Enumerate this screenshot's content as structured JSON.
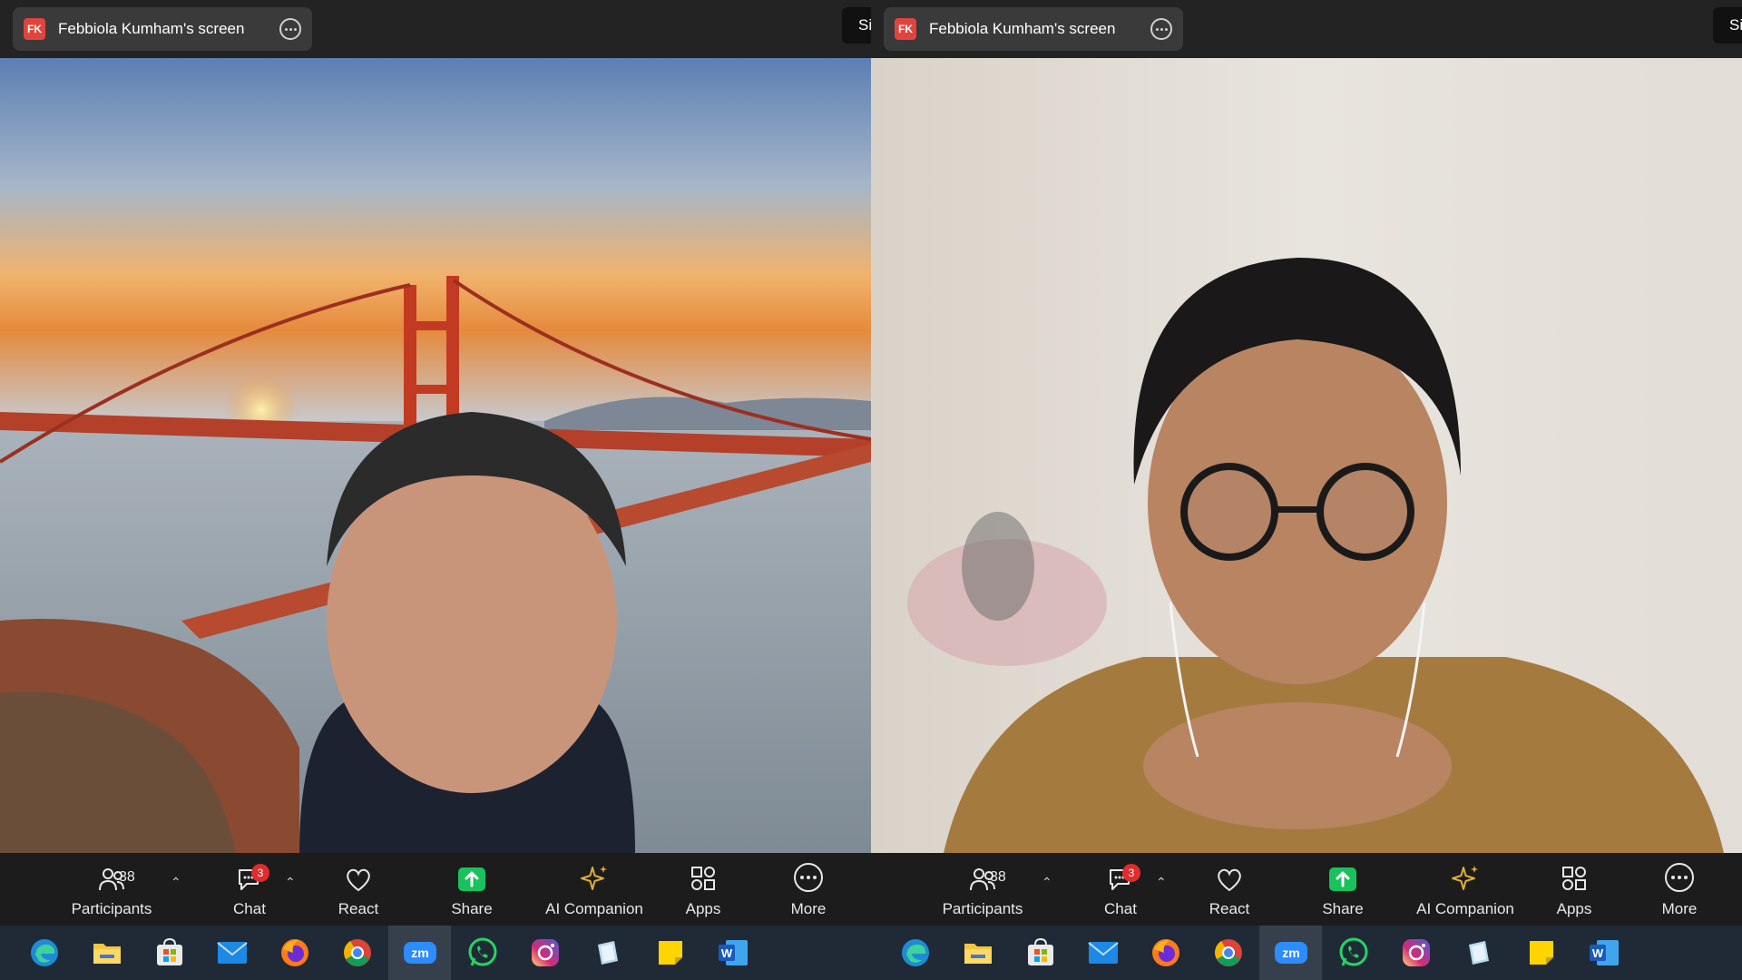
{
  "share_bar": {
    "initials": "FK",
    "title": "Febbiola Kumham's screen",
    "side_tab": "Si"
  },
  "controls": {
    "participants": {
      "label": "Participants",
      "count": "38"
    },
    "chat": {
      "label": "Chat",
      "badge": "3"
    },
    "react": {
      "label": "React"
    },
    "share": {
      "label": "Share"
    },
    "ai_companion": {
      "label": "AI Companion"
    },
    "apps": {
      "label": "Apps"
    },
    "more": {
      "label": "More"
    }
  },
  "colors": {
    "share_green": "#19c25c",
    "badge_red": "#e02c2c",
    "avatar_red": "#e0443d",
    "ai_gold": "#e0b035"
  },
  "taskbar_apps": [
    "edge-icon",
    "file-explorer-icon",
    "store-icon",
    "mail-icon",
    "firefox-icon",
    "chrome-icon",
    "zoom-icon",
    "whatsapp-icon",
    "instagram-icon",
    "notes-icon",
    "sticky-notes-icon",
    "word-icon"
  ]
}
